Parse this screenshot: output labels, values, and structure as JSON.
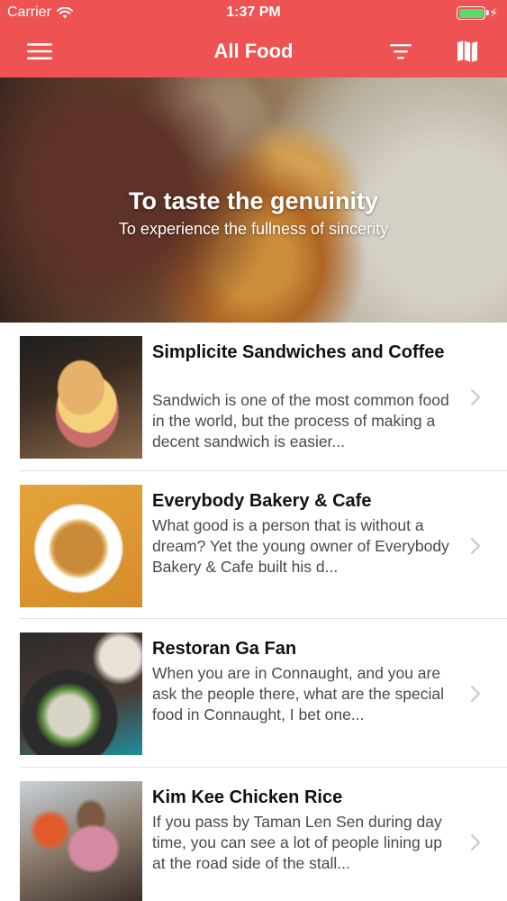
{
  "status_bar": {
    "carrier": "Carrier",
    "time": "1:37 PM",
    "battery_level": 1.0
  },
  "navbar": {
    "title": "All Food",
    "menu_icon": "hamburger-menu-icon",
    "filter_icon": "filter-icon",
    "map_icon": "map-icon"
  },
  "hero": {
    "title": "To taste the genuinity",
    "subtitle": "To experience the fullness of sincerity"
  },
  "items": [
    {
      "title": "Simplicite Sandwiches and Coffee",
      "description": "Sandwich is one of the most common food in the world, but the process of making a decent sandwich is easier..."
    },
    {
      "title": "Everybody Bakery & Cafe",
      "description": "What good is a person that is without a dream? Yet the young owner of Everybody Bakery & Cafe built his d..."
    },
    {
      "title": "Restoran Ga Fan",
      "description": "When you are in Connaught, and you are ask the people there, what are the special food in Connaught, I bet one..."
    },
    {
      "title": "Kim Kee Chicken Rice",
      "description": "If you pass by Taman Len Sen during day time, you can see a lot of people lining up at the road side of the stall..."
    }
  ],
  "colors": {
    "accent": "#ee5252",
    "battery": "#5cd96a",
    "chevron": "#c7c7cc"
  }
}
